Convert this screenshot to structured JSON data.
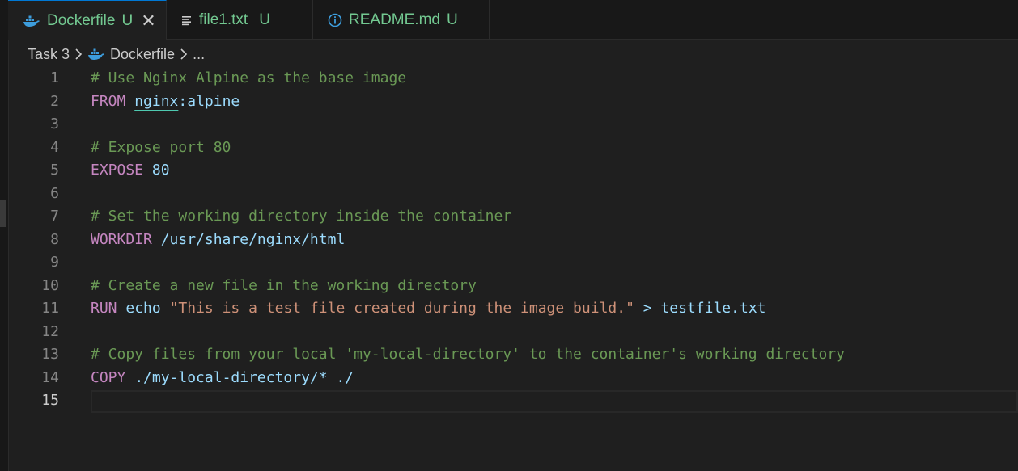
{
  "tabs": [
    {
      "label": "Dockerfile",
      "status": "U",
      "icon": "docker-whale-icon",
      "active": true,
      "close": "✕"
    },
    {
      "label": "file1.txt",
      "status": "U",
      "icon": "text-lines-icon",
      "active": false
    },
    {
      "label": "README.md",
      "status": "U",
      "icon": "info-circle-icon",
      "active": false
    }
  ],
  "breadcrumb": {
    "folder": "Task 3",
    "file": "Dockerfile",
    "more": "..."
  },
  "editor": {
    "current_line": 15,
    "lines": [
      {
        "n": "1",
        "tokens": [
          {
            "t": "# Use Nginx Alpine as the base image",
            "k": "comment"
          }
        ]
      },
      {
        "n": "2",
        "tokens": [
          {
            "t": "FROM",
            "k": "kw"
          },
          {
            "t": " ",
            "k": "plain"
          },
          {
            "t": "nginx",
            "k": "img-u"
          },
          {
            "t": ":alpine",
            "k": "img"
          }
        ]
      },
      {
        "n": "3",
        "tokens": []
      },
      {
        "n": "4",
        "tokens": [
          {
            "t": "# Expose port 80",
            "k": "comment"
          }
        ]
      },
      {
        "n": "5",
        "tokens": [
          {
            "t": "EXPOSE",
            "k": "kw"
          },
          {
            "t": " ",
            "k": "plain"
          },
          {
            "t": "80",
            "k": "num2"
          }
        ]
      },
      {
        "n": "6",
        "tokens": []
      },
      {
        "n": "7",
        "tokens": [
          {
            "t": "# Set the working directory inside the container",
            "k": "comment"
          }
        ]
      },
      {
        "n": "8",
        "tokens": [
          {
            "t": "WORKDIR",
            "k": "kw"
          },
          {
            "t": " ",
            "k": "plain"
          },
          {
            "t": "/usr/share/nginx/html",
            "k": "path"
          }
        ]
      },
      {
        "n": "9",
        "tokens": []
      },
      {
        "n": "10",
        "tokens": [
          {
            "t": "# Create a new file in the working directory",
            "k": "comment"
          }
        ]
      },
      {
        "n": "11",
        "tokens": [
          {
            "t": "RUN",
            "k": "kw"
          },
          {
            "t": " ",
            "k": "plain"
          },
          {
            "t": "echo",
            "k": "cmd"
          },
          {
            "t": " ",
            "k": "plain"
          },
          {
            "t": "\"This is a test file created during the image build.\"",
            "k": "str"
          },
          {
            "t": " ",
            "k": "plain"
          },
          {
            "t": ">",
            "k": "cmd"
          },
          {
            "t": " ",
            "k": "plain"
          },
          {
            "t": "testfile.txt",
            "k": "path"
          }
        ]
      },
      {
        "n": "12",
        "tokens": []
      },
      {
        "n": "13",
        "tokens": [
          {
            "t": "# Copy files from your local 'my-local-directory' to the container's working directory",
            "k": "comment"
          }
        ]
      },
      {
        "n": "14",
        "tokens": [
          {
            "t": "COPY",
            "k": "kw"
          },
          {
            "t": " ",
            "k": "plain"
          },
          {
            "t": "./my-local-directory/* ./",
            "k": "path"
          }
        ]
      },
      {
        "n": "15",
        "tokens": []
      }
    ]
  },
  "colors": {
    "background": "#1f1f1f",
    "tab_modified": "#73c991",
    "comment": "#6a9955",
    "keyword": "#c586c0",
    "string": "#ce9178",
    "identifier": "#9cdcfe"
  }
}
